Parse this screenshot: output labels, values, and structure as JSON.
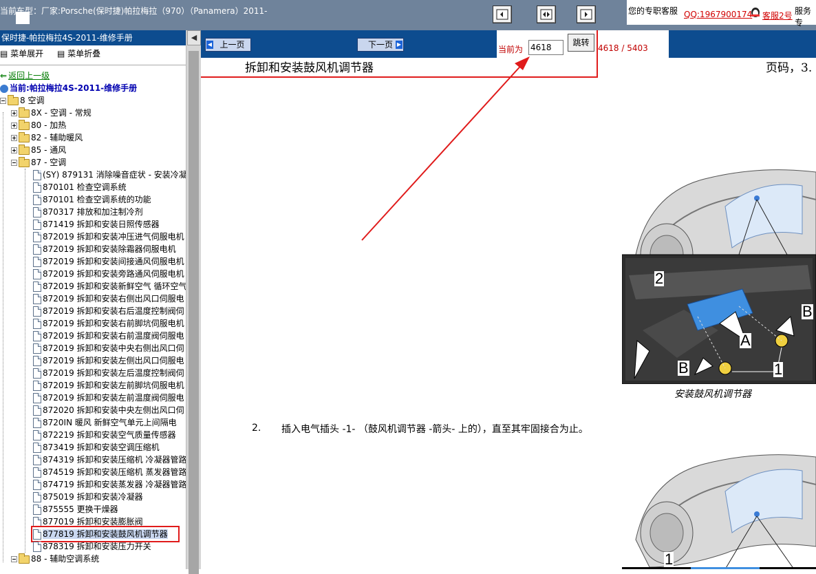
{
  "header": {
    "model_text": "当前车型：厂家:Porsche(保时捷)帕拉梅拉（970）（Panamera）2011-",
    "service_label": "您的专职客服",
    "qq_link": "QQ:1967900174",
    "kefu_link": "客服2号",
    "service_tail": "服务专"
  },
  "sidebar": {
    "title": "保时捷-帕拉梅拉4S-2011-维修手册",
    "expand_label": "菜单展开",
    "collapse_label": "菜单折叠",
    "back_label": "返回上一级",
    "current_label": "当前:帕拉梅拉4S-2011-维修手册",
    "root": "8 空调",
    "groups": [
      "8X - 空调 - 常规",
      "80 - 加热",
      "82 - 辅助暖风",
      "85 - 通风",
      "87 - 空调"
    ],
    "items": [
      "(SY) 879131 消除噪音症状 - 安装冷凝",
      "870101 检查空调系统",
      "870101 检查空调系统的功能",
      "870317 排放和加注制冷剂",
      "871419 拆卸和安装日照传感器",
      "872019 拆卸和安装冲压进气伺服电机",
      "872019 拆卸和安装除霜器伺服电机",
      "872019 拆卸和安装间接通风伺服电机",
      "872019 拆卸和安装旁路通风伺服电机",
      "872019 拆卸和安装新鲜空气 循环空气",
      "872019 拆卸和安装右侧出风口伺服电",
      "872019 拆卸和安装右后温度控制阀伺",
      "872019 拆卸和安装右前脚坑伺服电机",
      "872019 拆卸和安装右前温度阀伺服电",
      "872019 拆卸和安装中央右侧出风口伺",
      "872019 拆卸和安装左侧出风口伺服电",
      "872019 拆卸和安装左后温度控制阀伺",
      "872019 拆卸和安装左前脚坑伺服电机",
      "872019 拆卸和安装左前温度阀伺服电",
      "872020 拆卸和安装中央左侧出风口伺",
      "8720IN 暖风 新鲜空气单元上间隔电",
      "872219 拆卸和安装空气质量传感器",
      "873419 拆卸和安装空调压缩机",
      "874319 拆卸和安装压缩机 冷凝器管路",
      "874519 拆卸和安装压缩机 蒸发器管路",
      "874719 拆卸和安装蒸发器 冷凝器管路",
      "875019 拆卸和安装冷凝器",
      "875555 更换干燥器",
      "877019 拆卸和安装膨胀阀",
      "877819 拆卸和安装鼓风机调节器",
      "878319 拆卸和安装压力开关"
    ],
    "selected_index": 29,
    "last_group": "88 - 辅助空调系统"
  },
  "toolbar": {
    "prev_label": "上一页",
    "next_label": "下一页",
    "current_label": "当前为",
    "page_value": "4618",
    "go_label": "跳转",
    "total": "4618 / 5403"
  },
  "doc": {
    "title": "拆卸和安装鼓风机调节器",
    "page_label": "页码，3.",
    "figure_caption": "安装鼓风机调节器",
    "figure_labels": [
      "2",
      "B",
      "A",
      "B",
      "1",
      "1"
    ],
    "step_number": "2.",
    "step_text": "插入电气插头 -1- （鼓风机调节器 -箭头- 上的），直至其牢固接合为止。"
  },
  "colors": {
    "header_bg": "#6f839b",
    "navy": "#0d4c8f",
    "highlight": "#e01b1b",
    "link_red": "#d10000"
  }
}
